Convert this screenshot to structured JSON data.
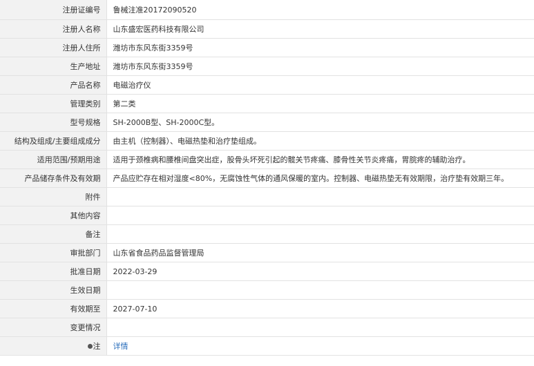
{
  "rows": [
    {
      "label": "注册证编号",
      "value": "鲁械注准20172090520"
    },
    {
      "label": "注册人名称",
      "value": "山东盛宏医药科技有限公司"
    },
    {
      "label": "注册人住所",
      "value": "潍坊市东风东街3359号"
    },
    {
      "label": "生产地址",
      "value": "潍坊市东风东街3359号"
    },
    {
      "label": "产品名称",
      "value": "电磁治疗仪"
    },
    {
      "label": "管理类别",
      "value": "第二类"
    },
    {
      "label": "型号规格",
      "value": "SH-2000B型、SH-2000C型。"
    },
    {
      "label": "结构及组成/主要组成成分",
      "value": "由主机（控制器）、电磁热垫和治疗垫组成。"
    },
    {
      "label": "适用范围/预期用途",
      "value": "适用于颈椎病和腰椎间盘突出症，股骨头坏死引起的髋关节疼痛、膝骨性关节炎疼痛，胃脘疼的辅助治疗。"
    },
    {
      "label": "产品储存条件及有效期",
      "value": "产品应贮存在相对湿度<80%，无腐蚀性气体的通风保暖的室内。控制器、电磁热垫无有效期限，治疗垫有效期三年。"
    },
    {
      "label": "附件",
      "value": ""
    },
    {
      "label": "其他内容",
      "value": ""
    },
    {
      "label": "备注",
      "value": ""
    },
    {
      "label": "审批部门",
      "value": "山东省食品药品监督管理局"
    },
    {
      "label": "批准日期",
      "value": "2022-03-29"
    },
    {
      "label": "生效日期",
      "value": ""
    },
    {
      "label": "有效期至",
      "value": "2027-07-10"
    },
    {
      "label": "变更情况",
      "value": ""
    }
  ],
  "note_row": {
    "icon": "pin-icon",
    "label": "注",
    "link_text": "详情",
    "link_color": "#2a6ebb"
  }
}
